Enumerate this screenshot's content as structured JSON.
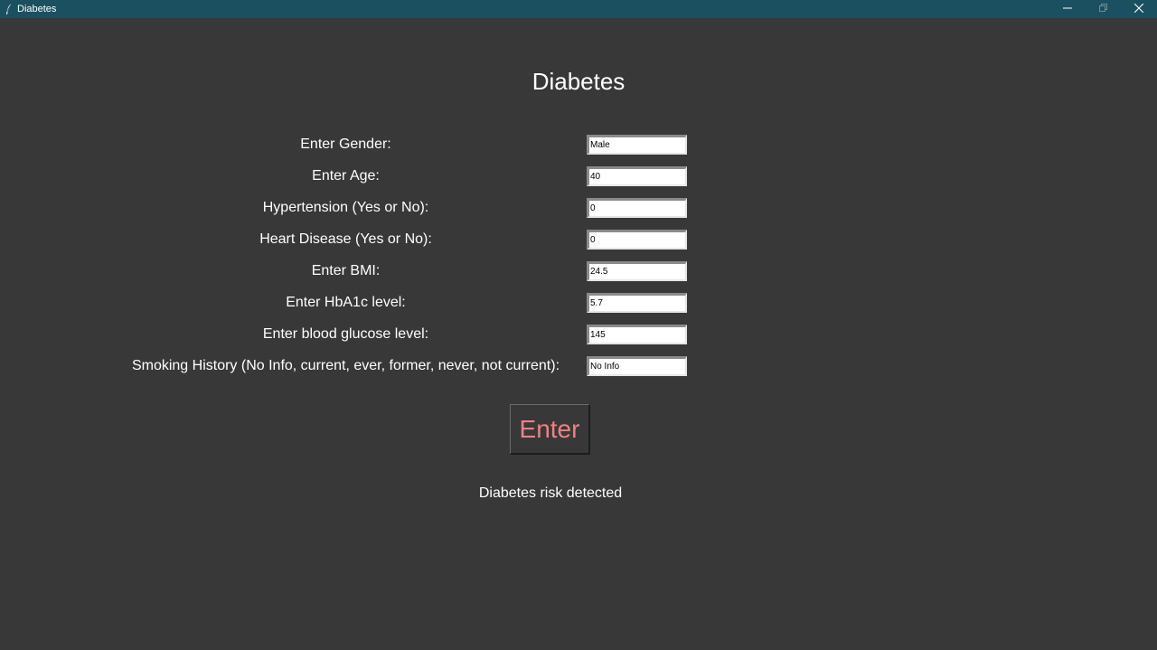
{
  "window": {
    "title": "Diabetes",
    "app_icon": "feather-icon",
    "controls": [
      "minimize-icon",
      "restore-icon",
      "close-icon"
    ],
    "titlebar_color": "#1a5060"
  },
  "heading": "Diabetes",
  "form": {
    "fields": [
      {
        "label": "Enter Gender:",
        "value": "Male"
      },
      {
        "label": "Enter Age:",
        "value": "40"
      },
      {
        "label": "Hypertension (Yes or No):",
        "value": "0"
      },
      {
        "label": "Heart Disease (Yes or No):",
        "value": "0"
      },
      {
        "label": "Enter BMI:",
        "value": "24.5"
      },
      {
        "label": "Enter HbA1c level:",
        "value": "5.7"
      },
      {
        "label": "Enter blood glucose level:",
        "value": "145"
      },
      {
        "label": "Smoking History (No Info, current, ever, former, never, not current):",
        "value": "No Info"
      }
    ],
    "submit_label": "Enter",
    "submit_color": "#f08080"
  },
  "result": "Diabetes risk detected",
  "background_color": "#383838"
}
